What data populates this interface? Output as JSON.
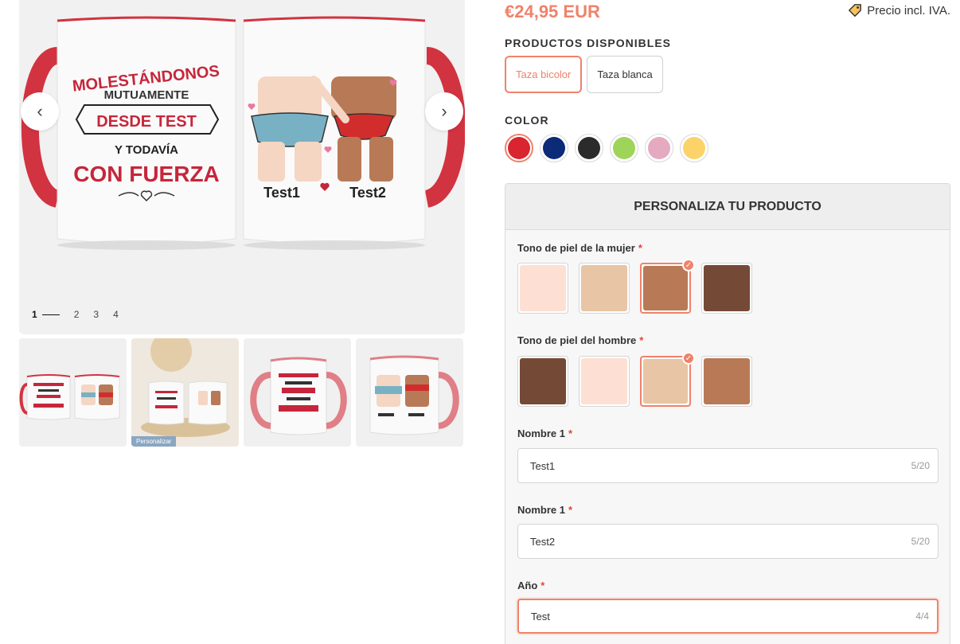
{
  "gallery": {
    "mug_left": {
      "line1": "MOLESTÁNDONOS",
      "line2": "MUTUAMENTE",
      "line3": "DESDE TEST",
      "line4": "Y TODAVÍA",
      "line5": "CON FUERZA"
    },
    "mug_right": {
      "name1": "Test1",
      "name2": "Test2"
    },
    "pager": [
      "1",
      "2",
      "3",
      "4"
    ],
    "thumb_tag": "Personalizar"
  },
  "product": {
    "price": "€24,95 EUR",
    "tax_note": "Precio incl. IVA.",
    "products_title": "PRODUCTOS DISPONIBLES",
    "products": [
      {
        "label": "Taza bicolor",
        "selected": true
      },
      {
        "label": "Taza blanca",
        "selected": false
      }
    ],
    "color_title": "COLOR",
    "colors": [
      {
        "hex": "#d9252f",
        "selected": true
      },
      {
        "hex": "#0b2a78",
        "selected": false
      },
      {
        "hex": "#2b2b2b",
        "selected": false
      },
      {
        "hex": "#9fd45a",
        "selected": false
      },
      {
        "hex": "#e5a9c0",
        "selected": false
      },
      {
        "hex": "#fcd369",
        "selected": false
      }
    ]
  },
  "personalize": {
    "title": "PERSONALIZA TU PRODUCTO",
    "tone_woman_label": "Tono de piel de la mujer",
    "tone_man_label": "Tono de piel del hombre",
    "tones_woman": [
      {
        "hex": "#fde0d3",
        "selected": false
      },
      {
        "hex": "#e8c5a5",
        "selected": false
      },
      {
        "hex": "#b87a56",
        "selected": true
      },
      {
        "hex": "#744a37",
        "selected": false
      }
    ],
    "tones_man": [
      {
        "hex": "#744a37",
        "selected": false
      },
      {
        "hex": "#fde0d3",
        "selected": false
      },
      {
        "hex": "#e8c5a5",
        "selected": true
      },
      {
        "hex": "#b87a56",
        "selected": false
      }
    ],
    "name1_label": "Nombre 1",
    "name1_value": "Test1",
    "name1_count": "5/20",
    "name2_label": "Nombre 1",
    "name2_value": "Test2",
    "name2_count": "5/20",
    "year_label": "Año",
    "year_value": "Test",
    "year_count": "4/4",
    "required_mark": "*"
  },
  "colors": {
    "accent": "#f0826a",
    "mug_red": "#d9252f"
  }
}
